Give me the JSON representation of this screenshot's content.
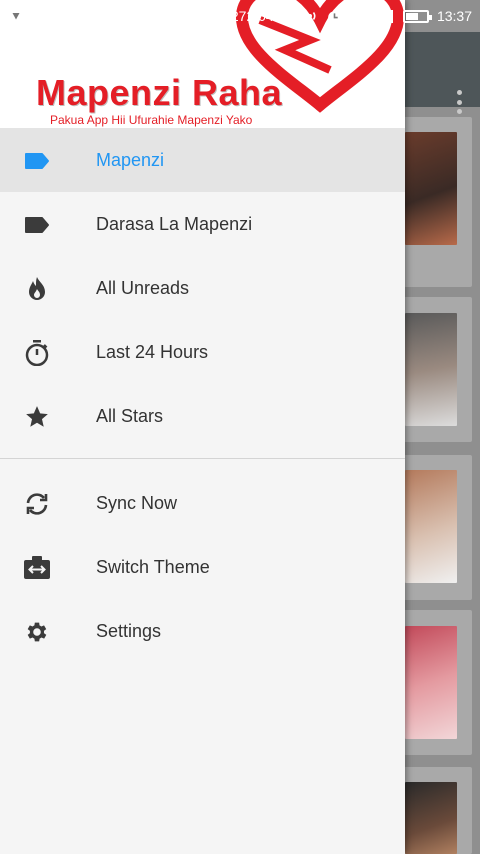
{
  "status_bar": {
    "network_speed": "272.04K/s",
    "time": "13:37",
    "icons": [
      "vpn-icon",
      "whatsapp-icon",
      "hotspot-icon",
      "wifi-icon",
      "alarm-icon",
      "signal-icon",
      "signal-icon",
      "battery-icon"
    ]
  },
  "header": {
    "brand_title": "Mapenzi Raha",
    "brand_subtitle": "Pakua App Hii Ufurahie Mapenzi Yako",
    "brand_color": "#e41e26"
  },
  "drawer": {
    "items": [
      {
        "label": "Mapenzi",
        "icon": "label-icon",
        "active": true
      },
      {
        "label": "Darasa La Mapenzi",
        "icon": "label-icon",
        "active": false
      },
      {
        "label": "All Unreads",
        "icon": "fire-icon",
        "active": false
      },
      {
        "label": "Last 24 Hours",
        "icon": "timer-icon",
        "active": false
      },
      {
        "label": "All Stars",
        "icon": "star-icon",
        "active": false
      }
    ],
    "secondary_items": [
      {
        "label": "Sync Now",
        "icon": "sync-icon"
      },
      {
        "label": "Switch Theme",
        "icon": "switch-theme-icon"
      },
      {
        "label": "Settings",
        "icon": "gear-icon"
      }
    ],
    "active_color": "#2196f3"
  },
  "background": {
    "toolbar_menu_icon": "more-vertical-icon"
  }
}
